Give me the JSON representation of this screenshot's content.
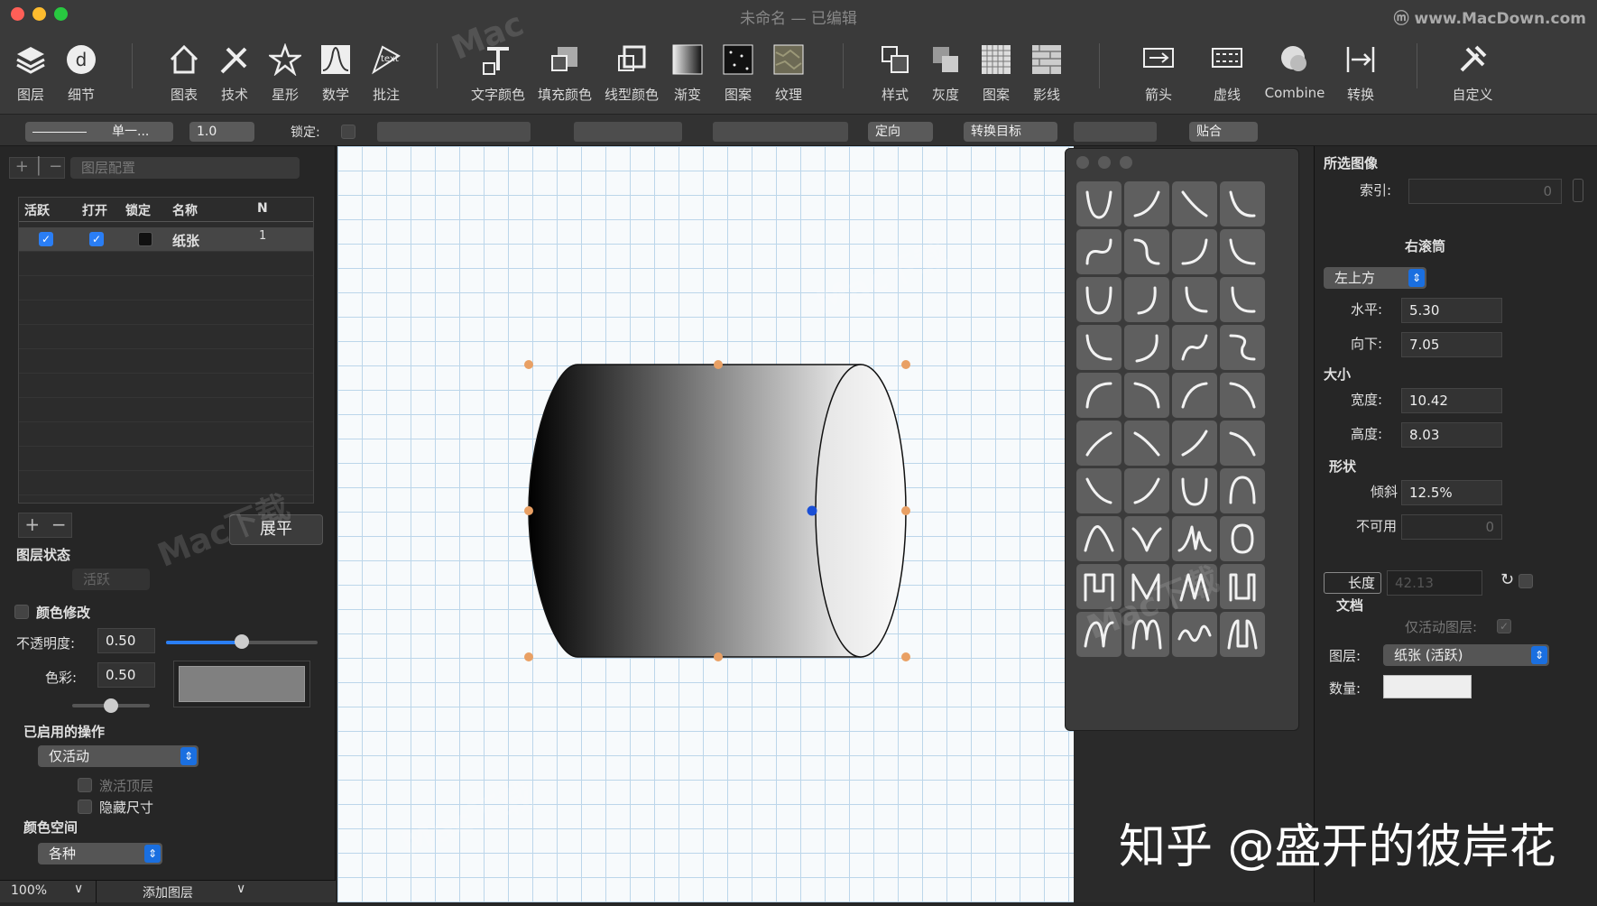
{
  "window": {
    "title": "未命名 — 已编辑",
    "watermark_site": "ⓜ www.MacDown.com"
  },
  "toolbar": {
    "items": [
      {
        "label": "图层",
        "icon": "layers-icon"
      },
      {
        "label": "细节",
        "icon": "detail-icon"
      },
      {
        "label": "图表",
        "icon": "house-icon"
      },
      {
        "label": "技术",
        "icon": "tech-icon"
      },
      {
        "label": "星形",
        "icon": "star-icon"
      },
      {
        "label": "数学",
        "icon": "math-icon"
      },
      {
        "label": "批注",
        "icon": "annotation-icon"
      },
      {
        "label": "文字颜色",
        "icon": "text-color-icon"
      },
      {
        "label": "填充颜色",
        "icon": "fill-color-icon"
      },
      {
        "label": "线型颜色",
        "icon": "line-color-icon"
      },
      {
        "label": "渐变",
        "icon": "gradient-icon"
      },
      {
        "label": "图案",
        "icon": "pattern-icon"
      },
      {
        "label": "纹理",
        "icon": "texture-icon"
      },
      {
        "label": "样式",
        "icon": "style-icon"
      },
      {
        "label": "灰度",
        "icon": "grayscale-icon"
      },
      {
        "label": "图案",
        "icon": "grid-pattern-icon"
      },
      {
        "label": "影线",
        "icon": "hatch-icon"
      },
      {
        "label": "箭头",
        "icon": "arrow-icon"
      },
      {
        "label": "虚线",
        "icon": "dashline-icon"
      },
      {
        "label": "Combine",
        "icon": "combine-icon"
      },
      {
        "label": "转换",
        "icon": "convert-icon"
      },
      {
        "label": "自定义",
        "icon": "customize-icon"
      }
    ]
  },
  "optbar": {
    "line_style": "单一...",
    "line_width": "1.0",
    "lock_label": "锁定:",
    "direction": "定向",
    "convert_target": "转换目标",
    "snap": "贴合"
  },
  "left": {
    "layer_config": "图层配置",
    "table_headers": [
      "活跃",
      "打开",
      "锁定",
      "名称",
      "N"
    ],
    "row": {
      "name": "纸张",
      "n": "1"
    },
    "flatten_button": "展平",
    "layer_state": "图层状态",
    "state_value": "活跃",
    "color_modify": "颜色修改",
    "opacity_label": "不透明度:",
    "opacity_value": "0.50",
    "opacity_fraction": 0.5,
    "color_label": "色彩:",
    "color_value": "0.50",
    "color_fraction": 0.5,
    "enabled_ops": "已启用的操作",
    "enabled_value": "仅活动",
    "activate_top": "激活顶层",
    "hide_size": "隐藏尺寸",
    "color_space": "颜色空间",
    "color_space_value": "各种",
    "zoom": "100%",
    "add_layer": "添加图层"
  },
  "right": {
    "selected_image": "所选图像",
    "index_label": "索引:",
    "index_value": "0",
    "shape_name": "右滚筒",
    "anchor": "左上方",
    "horizontal_label": "水平:",
    "horizontal_value": "5.30",
    "down_label": "向下:",
    "down_value": "7.05",
    "size_label": "大小",
    "width_label": "宽度:",
    "width_value": "10.42",
    "height_label": "高度:",
    "height_value": "8.03",
    "shape_label": "形状",
    "skew_label": "倾斜",
    "skew_value": "12.5%",
    "disabled_label": "不可用",
    "disabled_value": "0",
    "length_button": "长度",
    "length_value": "42.13",
    "doc_label": "文档",
    "active_only": "仅活动图层:",
    "layer_label": "图层:",
    "layer_value": "纸张 (活跃)",
    "count_label": "数量:"
  },
  "bottom_watermark": "知乎 @盛开的彼岸花"
}
